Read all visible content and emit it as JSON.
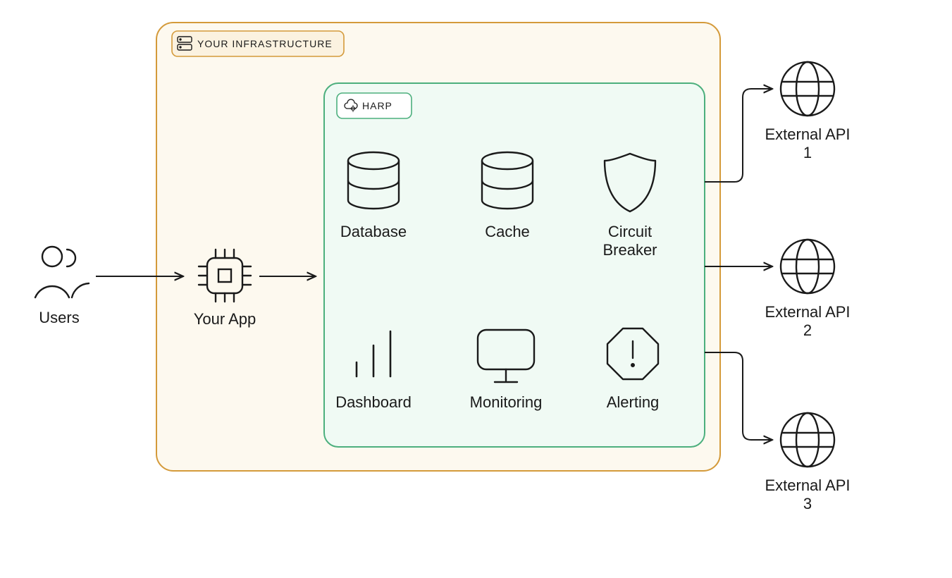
{
  "nodes": {
    "users": "Users",
    "your_app": "Your App",
    "infrastructure_label": "YOUR INFRASTRUCTURE",
    "harp_label": "HARP",
    "database": "Database",
    "cache": "Cache",
    "circuit_breaker_1": "Circuit",
    "circuit_breaker_2": "Breaker",
    "dashboard": "Dashboard",
    "monitoring": "Monitoring",
    "alerting": "Alerting",
    "ext_api_1a": "External API",
    "ext_api_1b": "1",
    "ext_api_2a": "External API",
    "ext_api_2b": "2",
    "ext_api_3a": "External API",
    "ext_api_3b": "3"
  },
  "colors": {
    "orange": "#d49a3a",
    "green": "#4caf7d",
    "ink": "#1a1a1a",
    "cream": "#fdf9ef",
    "mint": "#f0faf4"
  }
}
